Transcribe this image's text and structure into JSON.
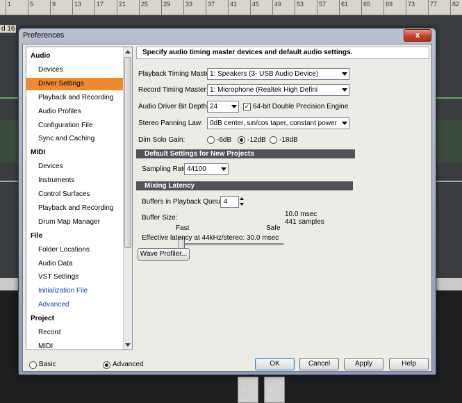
{
  "background": {
    "ruler_ticks": [
      "1",
      "5",
      "9",
      "13",
      "17",
      "21",
      "25",
      "29",
      "33",
      "37",
      "41",
      "45",
      "49",
      "53",
      "57",
      "61",
      "65",
      "69",
      "73",
      "77",
      "82"
    ],
    "track_label": "d 16",
    "fader_labels": [
      "-6",
      "-12",
      "-6",
      "-12"
    ]
  },
  "dialog": {
    "title": "Preferences",
    "close_glyph": "x"
  },
  "tree": {
    "items": [
      {
        "label": "Audio",
        "type": "head"
      },
      {
        "label": "Devices",
        "type": "child"
      },
      {
        "label": "Driver Settings",
        "type": "child",
        "selected": true
      },
      {
        "label": "Playback and Recording",
        "type": "child"
      },
      {
        "label": "Audio Profiles",
        "type": "child"
      },
      {
        "label": "Configuration File",
        "type": "child"
      },
      {
        "label": "Sync and Caching",
        "type": "child"
      },
      {
        "label": "MIDI",
        "type": "head"
      },
      {
        "label": "Devices",
        "type": "child"
      },
      {
        "label": "Instruments",
        "type": "child"
      },
      {
        "label": "Control Surfaces",
        "type": "child"
      },
      {
        "label": "Playback and Recording",
        "type": "child"
      },
      {
        "label": "Drum Map Manager",
        "type": "child"
      },
      {
        "label": "File",
        "type": "head"
      },
      {
        "label": "Folder Locations",
        "type": "child"
      },
      {
        "label": "Audio Data",
        "type": "child"
      },
      {
        "label": "VST Settings",
        "type": "child"
      },
      {
        "label": "Initialization File",
        "type": "child",
        "link": true
      },
      {
        "label": "Advanced",
        "type": "child",
        "link": true
      },
      {
        "label": "Project",
        "type": "head"
      },
      {
        "label": "Record",
        "type": "child"
      },
      {
        "label": "MIDI",
        "type": "child"
      }
    ]
  },
  "panel": {
    "header": "Specify audio timing master devices and default audio settings.",
    "playback_master_label": "Playback Timing Master:",
    "playback_master_value": "1: Speakers (3- USB Audio Device)",
    "record_master_label": "Record Timing Master:",
    "record_master_value": "1: Microphone (Realtek High Defini",
    "bit_depth_label": "Audio Driver Bit Depth:",
    "bit_depth_value": "24",
    "double_precision_label": "64-bit Double Precision Engine",
    "double_precision_checked": true,
    "panning_label": "Stereo Panning Law:",
    "panning_value": "0dB center, sin/cos taper, constant power",
    "dim_solo_label": "Dim Solo Gain:",
    "dim_solo_options": [
      "-6dB",
      "-12dB",
      "-18dB"
    ],
    "dim_solo_selected": "-12dB",
    "default_settings_header": "Default Settings for New Projects",
    "sampling_rate_label": "Sampling Rate:",
    "sampling_rate_value": "44100",
    "mixing_latency_header": "Mixing Latency",
    "buffers_label": "Buffers in Playback Queue:",
    "buffers_value": "4",
    "buffer_size_label": "Buffer Size:",
    "buffer_size_fraction": 0.0,
    "buffer_msec": "10.0 msec",
    "buffer_samples": "441 samples",
    "fast_label": "Fast",
    "safe_label": "Safe",
    "effective_latency": "Effective latency at 44kHz/stereo:  30.0 msec",
    "wave_profiler_label": "Wave Profiler..."
  },
  "footer": {
    "basic_label": "Basic",
    "advanced_label": "Advanced",
    "mode_selected": "Advanced",
    "ok_label": "OK",
    "cancel_label": "Cancel",
    "apply_label": "Apply",
    "help_label": "Help"
  }
}
